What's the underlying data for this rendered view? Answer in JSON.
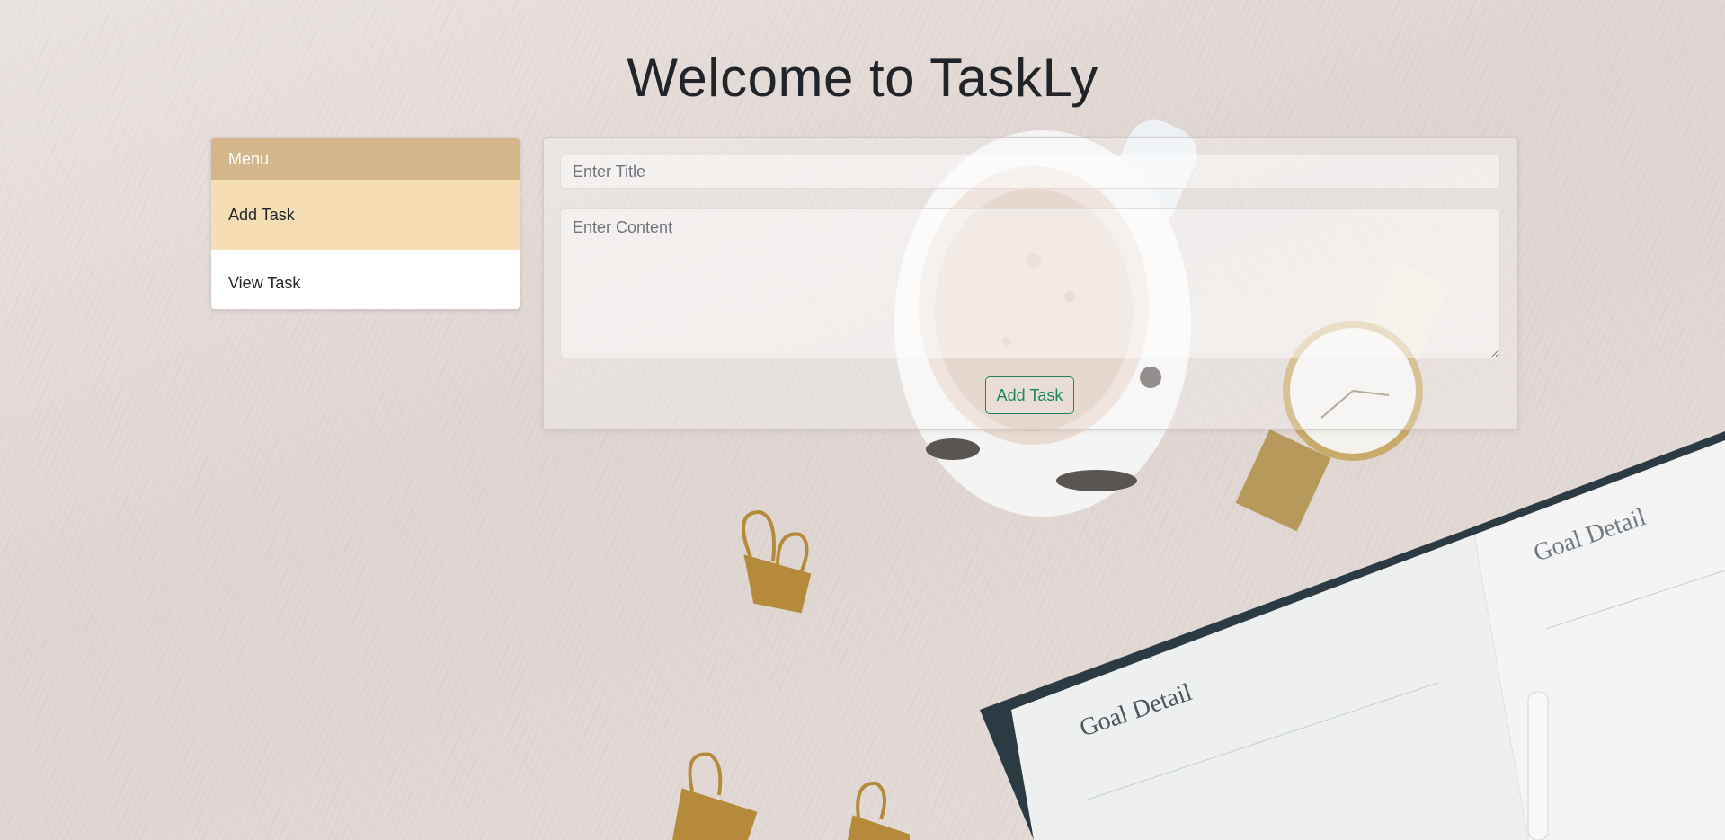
{
  "page": {
    "title": "Welcome to TaskLy"
  },
  "menu": {
    "header": "Menu",
    "items": [
      {
        "label": "Add Task",
        "active": true
      },
      {
        "label": "View Task",
        "active": false
      }
    ]
  },
  "form": {
    "title_placeholder": "Enter Title",
    "title_value": "",
    "content_placeholder": "Enter Content",
    "content_value": "",
    "submit_label": "Add Task"
  },
  "colors": {
    "menu_header": "#d4b68a",
    "menu_active": "#f5deb3",
    "button_outline": "#198754"
  }
}
